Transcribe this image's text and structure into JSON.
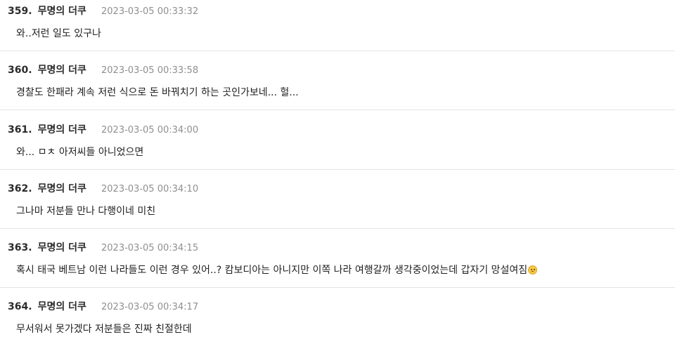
{
  "comments": [
    {
      "number": "359.",
      "author": "무명의 더쿠",
      "time": "2023-03-05 00:33:32",
      "text": "와..저런 일도 있구나"
    },
    {
      "number": "360.",
      "author": "무명의 더쿠",
      "time": "2023-03-05 00:33:58",
      "text": "경찰도 한패라 계속 저런 식으로 돈 바꿔치기 하는 곳인가보네... 헐..."
    },
    {
      "number": "361.",
      "author": "무명의 더쿠",
      "time": "2023-03-05 00:34:00",
      "text": "와... ㅁㅊ 아저씨들 아니었으면"
    },
    {
      "number": "362.",
      "author": "무명의 더쿠",
      "time": "2023-03-05 00:34:10",
      "text": "그나마 저분들 만나 다행이네 미친"
    },
    {
      "number": "363.",
      "author": "무명의 더쿠",
      "time": "2023-03-05 00:34:15",
      "text": "혹시 태국 베트남 이런 나라들도 이런 경우 있어..? 캄보디아는 아니지만 이쪽 나라 여행갈까 생각중이었는데 갑자기 망설여짐",
      "emoji": "worried-face-icon"
    },
    {
      "number": "364.",
      "author": "무명의 더쿠",
      "time": "2023-03-05 00:34:17",
      "text": "무서워서 못가겠다 저분들은 진짜 친절한데"
    }
  ]
}
